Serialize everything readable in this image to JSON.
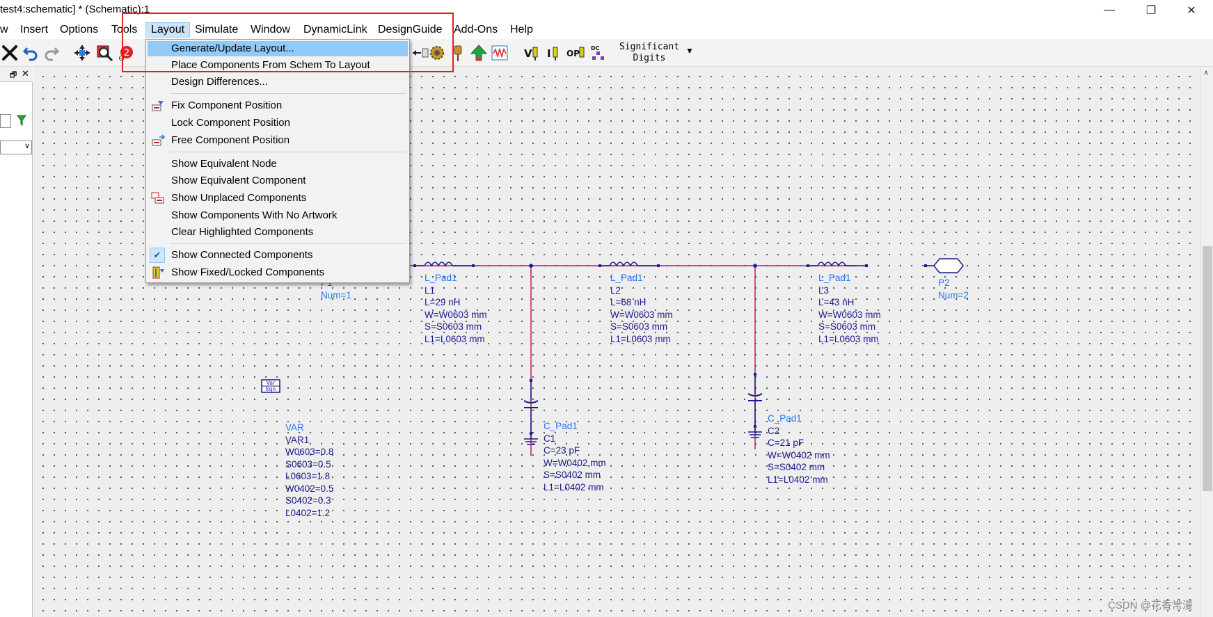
{
  "window": {
    "title": "test4:schematic] * (Schematic):1",
    "minimize": "—",
    "maximize": "❐",
    "close": "✕"
  },
  "menubar": {
    "items": [
      "w",
      "Insert",
      "Options",
      "Tools",
      "Layout",
      "Simulate",
      "Window",
      "DynamicLink",
      "DesignGuide",
      "Add-Ons",
      "Help"
    ],
    "active": "Layout"
  },
  "toolbar": {
    "significant_digits_line1": "Significant",
    "significant_digits_line2": "Digits",
    "icons": [
      "delete-icon",
      "undo-icon",
      "redo-icon",
      "move-icon",
      "zoom-icon",
      "swap-icon",
      "generate-icon",
      "gear-icon",
      "pin-icon",
      "push-up-icon",
      "waveform-icon",
      "vi-probe-icon",
      "i-probe-icon",
      "op-probe-icon",
      "dc-annotate-icon"
    ]
  },
  "layout_menu": {
    "items": [
      {
        "label": "Generate/Update Layout...",
        "highlighted": true
      },
      {
        "label": "Place Components From Schem To Layout"
      },
      {
        "label": "Design Differences..."
      },
      {
        "label": "Fix Component Position",
        "icon": "fix-position-icon"
      },
      {
        "label": "Lock Component Position"
      },
      {
        "label": "Free Component Position",
        "icon": "free-position-icon"
      },
      {
        "label": "Show Equivalent Node"
      },
      {
        "label": "Show Equivalent Component"
      },
      {
        "label": "Show Unplaced Components",
        "icon": "unplaced-icon"
      },
      {
        "label": "Show Components With No Artwork"
      },
      {
        "label": "Clear Highlighted Components"
      },
      {
        "label": "Show Connected Components",
        "checked": true
      },
      {
        "label": "Show Fixed/Locked Components",
        "icon": "fixed-locked-icon"
      }
    ]
  },
  "schematic": {
    "p1": {
      "name": "P1",
      "num": "Num=1"
    },
    "p2": {
      "name": "P2",
      "num": "Num=2"
    },
    "l1": {
      "model": "L_Pad1",
      "name": "L1",
      "l": "L=29 nH",
      "w": "W=W0603 mm",
      "s": "S=S0603 mm",
      "l1": "L1=L0603 mm"
    },
    "l2": {
      "model": "L_Pad1",
      "name": "L2",
      "l": "L=68 nH",
      "w": "W=W0603 mm",
      "s": "S=S0603 mm",
      "l1": "L1=L0603 mm"
    },
    "l3": {
      "model": "L_Pad1",
      "name": "L3",
      "l": "L=43 nH",
      "w": "W=W0603 mm",
      "s": "S=S0603 mm",
      "l1": "L1=L0603 mm"
    },
    "c1": {
      "model": "C_Pad1",
      "name": "C1",
      "c": "C=23 pF",
      "w": "W=W0402 mm",
      "s": "S=S0402 mm",
      "l1": "L1=L0402 mm"
    },
    "c2": {
      "model": "C_Pad1",
      "name": "C2",
      "c": "C=21 pF",
      "w": "W=W0402 mm",
      "s": "S=S0402 mm",
      "l1": "L1=L0402 mm"
    },
    "var": {
      "icon_line1": "Var",
      "icon_line2": "Eqn",
      "type": "VAR",
      "name": "VAR1",
      "lines": [
        "W0603=0.8",
        "S0603=0.5",
        "L0603=1.8",
        "W0402=0.5",
        "S0402=0.3",
        "L0402=1.2"
      ]
    }
  },
  "colors": {
    "wire": "#c0186e",
    "component": "#1a1a8a",
    "model_label": "#2277ee",
    "highlight": "#91c9f7",
    "annotation_box": "#e02020"
  },
  "watermark": "CSDN @花香常漫"
}
